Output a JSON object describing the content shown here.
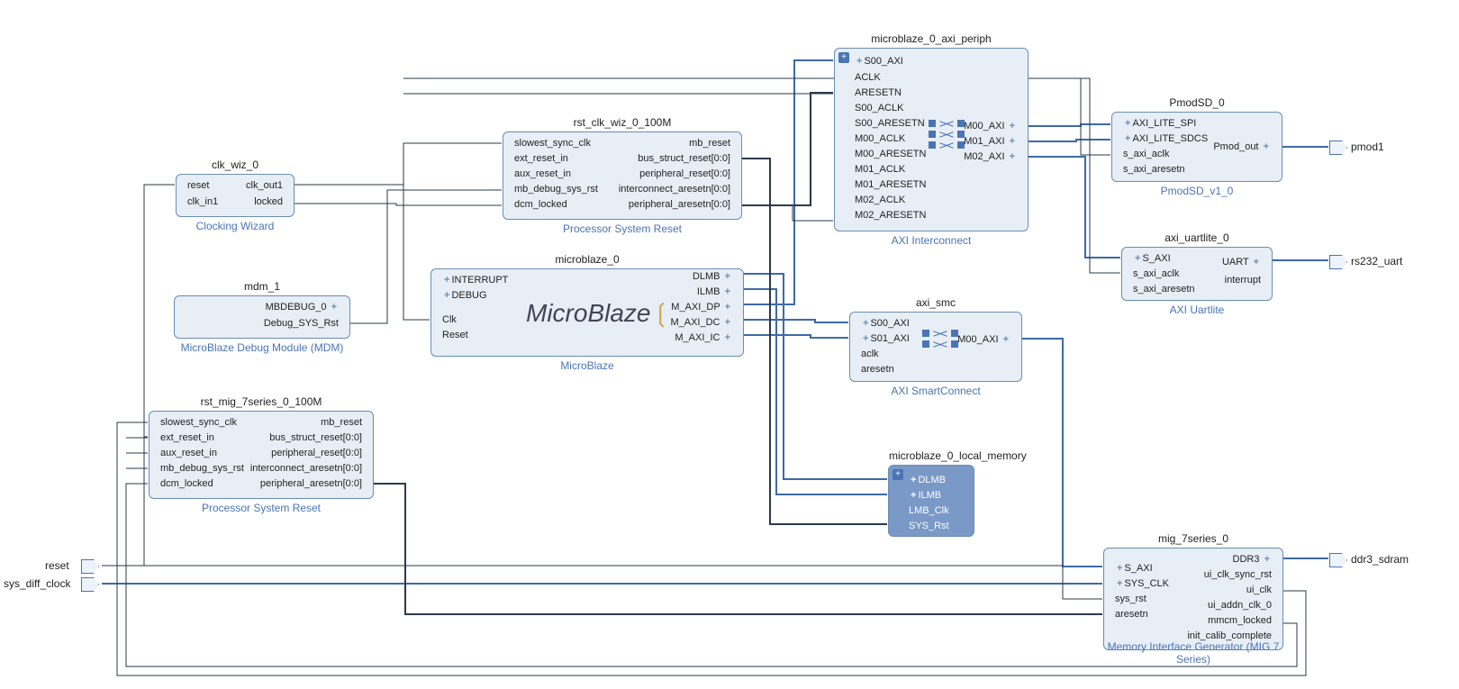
{
  "ext_ports_left": {
    "reset": "reset",
    "sys_diff_clock": "sys_diff_clock"
  },
  "ext_ports_right": {
    "pmod1": "pmod1",
    "rs232_uart": "rs232_uart",
    "ddr3_sdram": "ddr3_sdram"
  },
  "clk_wiz": {
    "title": "clk_wiz_0",
    "footer": "Clocking Wizard",
    "in": {
      "reset": "reset",
      "clk_in1": "clk_in1"
    },
    "out": {
      "clk_out1": "clk_out1",
      "locked": "locked"
    }
  },
  "mdm": {
    "title": "mdm_1",
    "footer": "MicroBlaze Debug Module (MDM)",
    "out": {
      "mbdebug": "MBDEBUG_0",
      "debug_sys_rst": "Debug_SYS_Rst"
    }
  },
  "rst_mig": {
    "title": "rst_mig_7series_0_100M",
    "footer": "Processor System Reset",
    "in": {
      "slowest": "slowest_sync_clk",
      "ext": "ext_reset_in",
      "aux": "aux_reset_in",
      "mb": "mb_debug_sys_rst",
      "dcm": "dcm_locked"
    },
    "out": {
      "mb_reset": "mb_reset",
      "bus": "bus_struct_reset[0:0]",
      "periph": "peripheral_reset[0:0]",
      "interconn": "interconnect_aresetn[0:0]",
      "periph_ar": "peripheral_aresetn[0:0]"
    }
  },
  "rst_clk": {
    "title": "rst_clk_wiz_0_100M",
    "footer": "Processor System Reset",
    "in": {
      "slowest": "slowest_sync_clk",
      "ext": "ext_reset_in",
      "aux": "aux_reset_in",
      "mb": "mb_debug_sys_rst",
      "dcm": "dcm_locked"
    },
    "out": {
      "mb_reset": "mb_reset",
      "bus": "bus_struct_reset[0:0]",
      "periph": "peripheral_reset[0:0]",
      "interconn": "interconnect_aresetn[0:0]",
      "periph_ar": "peripheral_aresetn[0:0]"
    }
  },
  "microblaze": {
    "title": "microblaze_0",
    "footer": "MicroBlaze",
    "logo": "MicroBlaze",
    "in": {
      "interrupt": "INTERRUPT",
      "debug": "DEBUG",
      "clk": "Clk",
      "reset": "Reset"
    },
    "out": {
      "dlmb": "DLMB",
      "ilmb": "ILMB",
      "m_axi_dp": "M_AXI_DP",
      "m_axi_dc": "M_AXI_DC",
      "m_axi_ic": "M_AXI_IC"
    }
  },
  "axi_periph": {
    "title": "microblaze_0_axi_periph",
    "footer": "AXI Interconnect",
    "in": {
      "s00_axi": "S00_AXI",
      "aclk": "ACLK",
      "aresetn": "ARESETN",
      "s00_aclk": "S00_ACLK",
      "s00_aresetn": "S00_ARESETN",
      "m00_aclk": "M00_ACLK",
      "m00_aresetn": "M00_ARESETN",
      "m01_aclk": "M01_ACLK",
      "m01_aresetn": "M01_ARESETN",
      "m02_aclk": "M02_ACLK",
      "m02_aresetn": "M02_ARESETN"
    },
    "out": {
      "m00": "M00_AXI",
      "m01": "M01_AXI",
      "m02": "M02_AXI"
    }
  },
  "axi_smc": {
    "title": "axi_smc",
    "footer": "AXI SmartConnect",
    "in": {
      "s00": "S00_AXI",
      "s01": "S01_AXI",
      "aclk": "aclk",
      "aresetn": "aresetn"
    },
    "out": {
      "m00": "M00_AXI"
    }
  },
  "local_mem": {
    "title": "microblaze_0_local_memory",
    "in": {
      "dlmb": "DLMB",
      "ilmb": "ILMB",
      "lmb_clk": "LMB_Clk",
      "sys_rst": "SYS_Rst"
    }
  },
  "pmodsd": {
    "title": "PmodSD_0",
    "footer": "PmodSD_v1_0",
    "in": {
      "spi": "AXI_LITE_SPI",
      "sdcs": "AXI_LITE_SDCS",
      "aclk": "s_axi_aclk",
      "aresetn": "s_axi_aresetn"
    },
    "out": {
      "pmod_out": "Pmod_out"
    }
  },
  "uartlite": {
    "title": "axi_uartlite_0",
    "footer": "AXI Uartlite",
    "in": {
      "s_axi": "S_AXI",
      "aclk": "s_axi_aclk",
      "aresetn": "s_axi_aresetn"
    },
    "out": {
      "uart": "UART",
      "interrupt": "interrupt"
    }
  },
  "mig": {
    "title": "mig_7series_0",
    "footer": "Memory Interface Generator (MIG 7 Series)",
    "in": {
      "s_axi": "S_AXI",
      "sys_clk": "SYS_CLK",
      "sys_rst": "sys_rst",
      "aresetn": "aresetn"
    },
    "out": {
      "ddr3": "DDR3",
      "ui_clk_sync_rst": "ui_clk_sync_rst",
      "ui_clk": "ui_clk",
      "ui_addn_clk_0": "ui_addn_clk_0",
      "mmcm_locked": "mmcm_locked",
      "init_calib": "init_calib_complete"
    }
  }
}
